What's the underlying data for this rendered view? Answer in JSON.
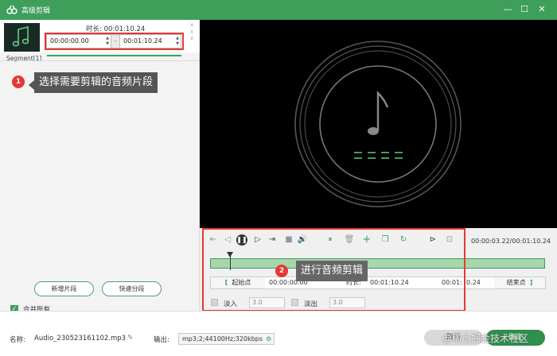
{
  "window": {
    "title": "高级剪辑",
    "min": "—",
    "max": "☐",
    "close": "✕"
  },
  "segment": {
    "duration_label": "时长: 00:01:10.24",
    "start": "00:00:00.00",
    "end": "00:01:10.24",
    "separator": "–",
    "label": "Segment[1]",
    "close": "✕"
  },
  "annotations": [
    {
      "num": "1",
      "text": "选择需要剪辑的音频片段"
    },
    {
      "num": "2",
      "text": "进行音频剪辑"
    }
  ],
  "left_buttons": {
    "new_segment": "新增片段",
    "quick_split": "快速分段"
  },
  "merge": {
    "label": "合并所有",
    "checked": true
  },
  "player": {
    "time_readout": "00:00:03.22/00:01:10.24",
    "start_btn": "起始点",
    "end_btn": "结束点",
    "start_time": "00:00:00.00",
    "duration_label": "时长:",
    "duration": "00:01:10.24",
    "end_time_a": "00:01:",
    "end_time_b": "0.24",
    "fade_in_label": "淡入",
    "fade_in_value": "3.0",
    "fade_out_label": "淡出",
    "fade_out_value": "3.0",
    "progress": 0.065
  },
  "bottom": {
    "name_label": "名称:",
    "name_value": "Audio_230523161102.mp3",
    "output_label": "输出:",
    "output_value": "mp3;2;44100Hz;320kbps",
    "cancel": "取消",
    "ok": "确定",
    "watermark": "@稀土掘金技术社区"
  },
  "colors": {
    "brand": "#3e9f5b",
    "accent_red": "#e53935",
    "preview_bg": "#000000"
  }
}
